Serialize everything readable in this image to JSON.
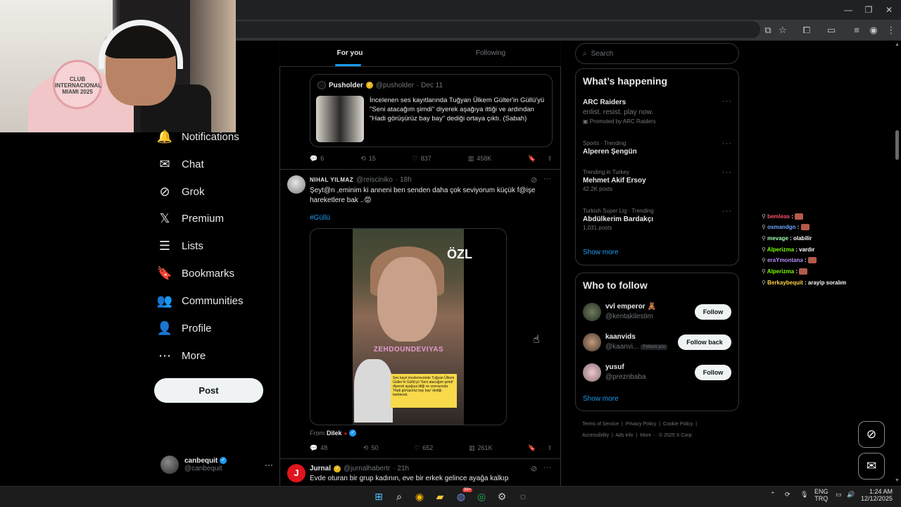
{
  "colors": {
    "accent": "#1d9bf0",
    "background": "#000000",
    "text": "#e7e9ea",
    "muted": "#71767b",
    "border": "#2f3336"
  },
  "webcam": {
    "badge_text": "CLUB INTERNACIONAL MIAMI 2025"
  },
  "nav": {
    "items": [
      {
        "label": "Notifications",
        "icon": "bell-icon",
        "glyph": "🔔"
      },
      {
        "label": "Chat",
        "icon": "mail-icon",
        "glyph": "✉"
      },
      {
        "label": "Grok",
        "icon": "grok-icon",
        "glyph": "⊘"
      },
      {
        "label": "Premium",
        "icon": "x-logo-icon",
        "glyph": "𝕏"
      },
      {
        "label": "Lists",
        "icon": "list-icon",
        "glyph": "☰"
      },
      {
        "label": "Bookmarks",
        "icon": "bookmark-icon",
        "glyph": "🔖"
      },
      {
        "label": "Communities",
        "icon": "people-icon",
        "glyph": "👥"
      },
      {
        "label": "Profile",
        "icon": "person-icon",
        "glyph": "👤"
      },
      {
        "label": "More",
        "icon": "more-circle-icon",
        "glyph": "⋯"
      }
    ],
    "post_label": "Post",
    "account": {
      "name": "canbequit",
      "handle": "@canbequit",
      "more": "···"
    }
  },
  "tabs": {
    "for_you": "For you",
    "following": "Following"
  },
  "tweet1": {
    "quote": {
      "name": "Pusholder",
      "handle": "@pusholder",
      "date": "· Dec 11",
      "text": "İncelenen ses kayıtlarında Tuğyan Ülkem Gülter'in Güllü'yü \"Seni atacağım şimdi\" diyerek aşağıya ittiği ve ardından \"Hadi görüşürüz bay bay\" dediği ortaya çıktı. (Sabah)"
    },
    "actions": {
      "replies": "6",
      "reposts": "15",
      "likes": "837",
      "views": "458K"
    }
  },
  "tweet2": {
    "name": "NIHAL YILMAZ",
    "handle": "@reisciniko",
    "time": "· 18h",
    "text": "Şeyt@n ,eminim ki anneni ben senden daha çok seviyorum küçük f@işe hareketlere bak ..😡",
    "hashtag": "#Güllü",
    "video_overlay": "ÖZL",
    "video_pink": "ZEHDOUNDEVIYAS",
    "video_caption": "Ses kayıt incelemesinde Tuğyan Ülkem Gülter'in Güllü'yü 'Seni atacağım şimdi' diyerek aşağıya ittiği ve sonrasında 'Hadi görüşürüz bay bay' dediği belirlendi.",
    "from_label": "From",
    "from_name": "Dilek",
    "actions": {
      "replies": "48",
      "reposts": "50",
      "likes": "652",
      "views": "261K"
    }
  },
  "tweet3": {
    "name": "Jurnal",
    "handle": "@jurnalhabertr",
    "time": "· 21h",
    "text": "Evde oturan bir grup kadının, eve bir erkek gelince ayağa kalkıp",
    "avatar_letter": "J"
  },
  "search": {
    "placeholder": "Search"
  },
  "whats_happening": {
    "title": "What’s happening",
    "promo": {
      "title": "ARC Raiders",
      "sub": "enlist. resist. play now.",
      "promoted": "Promoted by ARC Raiders"
    },
    "trends": [
      {
        "context": "Sports · Trending",
        "title": "Alperen Şengün",
        "posts": ""
      },
      {
        "context": "Trending in Turkey",
        "title": "Mehmet Akif Ersoy",
        "posts": "42.2K posts"
      },
      {
        "context": "Turkish Super Lig · Trending",
        "title": "Abdülkerim Bardakçı",
        "posts": "1,031 posts"
      }
    ],
    "show_more": "Show more"
  },
  "who_to_follow": {
    "title": "Who to follow",
    "users": [
      {
        "name": "vvl emperor 🧸",
        "handle": "@kentakilestim",
        "button": "Follow",
        "badge": ""
      },
      {
        "name": "kaanvids",
        "handle": "@kaanvi...",
        "button": "Follow back",
        "badge": "Follows you"
      },
      {
        "name": "yusuf",
        "handle": "@preznbaba",
        "button": "Follow",
        "badge": ""
      }
    ],
    "show_more": "Show more"
  },
  "footer": {
    "links": [
      "Terms of Service",
      "Privacy Policy",
      "Cookie Policy",
      "Accessibility",
      "Ads info",
      "More ···",
      "© 2025 X Corp."
    ]
  },
  "chat": [
    {
      "user": "bemleas",
      "color": "#ff4d6d",
      "msg": "",
      "emote": true
    },
    {
      "user": "osmandgn",
      "color": "#6fa8ff",
      "msg": "",
      "emote": true
    },
    {
      "user": "mevage",
      "color": "#a3ffb0",
      "msg": "olabilir",
      "emote": false
    },
    {
      "user": "Alperizma",
      "color": "#7cfc00",
      "msg": "vardır",
      "emote": false
    },
    {
      "user": "eraYmontana",
      "color": "#b98cff",
      "msg": "",
      "emote": true
    },
    {
      "user": "Alperizma",
      "color": "#7cfc00",
      "msg": "",
      "emote": true
    },
    {
      "user": "Berkaybequit",
      "color": "#ffd34d",
      "msg": "arayip soralım",
      "emote": false
    }
  ],
  "taskbar": {
    "lang": "ENG",
    "region": "TRQ",
    "time": "1:24 AM",
    "date": "12/12/2025",
    "badge": "99+"
  }
}
